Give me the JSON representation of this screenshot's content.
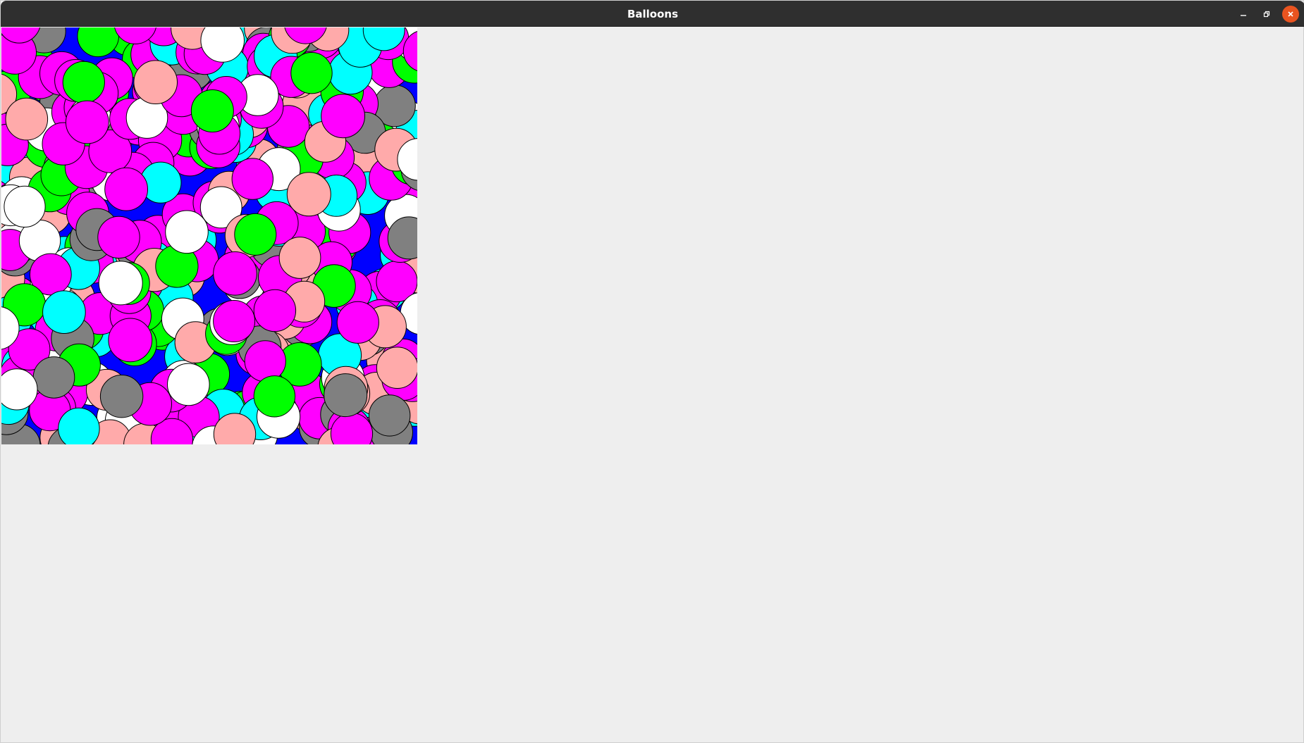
{
  "window": {
    "title": "Balloons"
  },
  "icons": {
    "minimize": "minimize-icon",
    "restore": "restore-icon",
    "close": "close-icon"
  },
  "colors": {
    "titlebar": "#2f2f2f",
    "window_background": "#eeeeee",
    "canvas_background": "#0000ff",
    "close_button": "#e95420",
    "balloon_outline": "#000000"
  },
  "balloon_palette": {
    "magenta": "#ff00ff",
    "cyan": "#00ffff",
    "green": "#00ff00",
    "pink": "#ffaaaa",
    "gray": "#808080",
    "white": "#ffffff"
  }
}
